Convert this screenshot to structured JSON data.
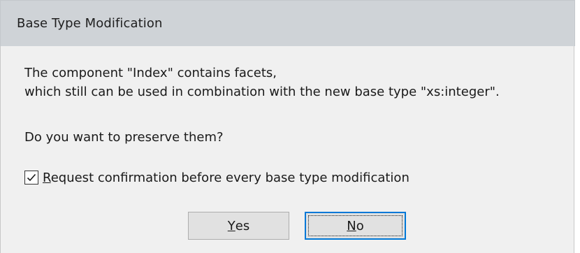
{
  "window": {
    "title": "Base Type Modification"
  },
  "message": {
    "line1": "The component \"Index\" contains facets,",
    "line2": "which still can be used in combination with the new base type \"xs:integer\".",
    "question": "Do you want to preserve them?"
  },
  "checkbox": {
    "checked": true,
    "label_mnemonic": "R",
    "label_rest": "equest confirmation before every base type modification",
    "icon": "checkmark-icon"
  },
  "buttons": {
    "yes_mnemonic": "Y",
    "yes_rest": "es",
    "no_mnemonic": "N",
    "no_rest": "o",
    "default": "no"
  },
  "colors": {
    "titlebar_bg": "#cfd3d7",
    "client_bg": "#f0f0f0",
    "button_bg": "#e1e1e1",
    "focus_border": "#0078d7"
  }
}
